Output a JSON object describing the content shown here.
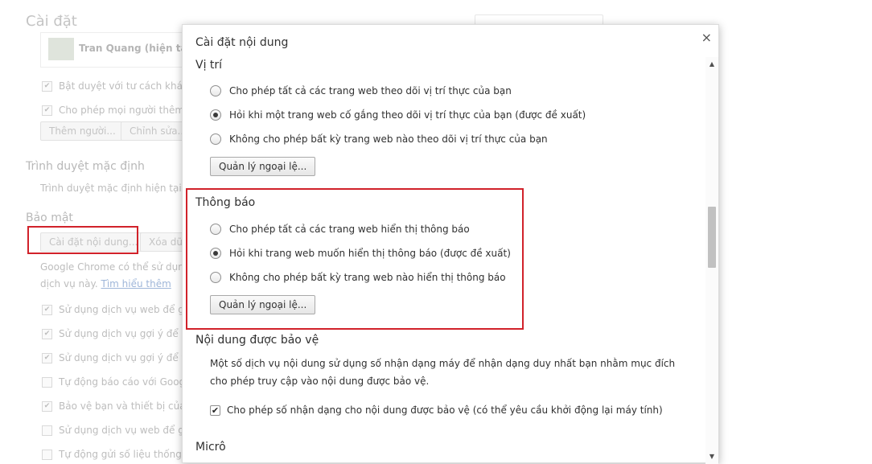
{
  "background": {
    "title": "Cài đặt",
    "profile_name": "Tran Quang (hiện tại)",
    "people_checkboxes": [
      {
        "label": "Bật duyệt với tư cách khách",
        "checked": true
      },
      {
        "label": "Cho phép mọi người thêm ng",
        "checked": true
      }
    ],
    "add_person_button": "Thêm người...",
    "edit_button": "Chỉnh sửa...",
    "default_browser_heading": "Trình duyệt mặc định",
    "default_browser_text": "Trình duyệt mặc định hiện tại là C",
    "security_heading": "Bảo mật",
    "content_settings_button": "Cài đặt nội dung...",
    "clear_data_button": "Xóa dữ",
    "info_text_line1": "Google Chrome có thể sử dụng d",
    "info_text_line2": "dịch vụ này.",
    "learn_more_link": "Tìm hiểu thêm",
    "security_checkboxes": [
      {
        "label": "Sử dụng dịch vụ web để giúp",
        "checked": true
      },
      {
        "label": "Sử dụng dịch vụ gợi ý để giú",
        "checked": true
      },
      {
        "label": "Sử dụng dịch vụ gợi ý để tải t",
        "checked": true
      },
      {
        "label": "Tự động báo cáo với Google",
        "checked": false
      },
      {
        "label": "Bảo vệ bạn và thiết bị của bạ",
        "checked": true
      },
      {
        "label": "Sử dụng dịch vụ web để giúp",
        "checked": false
      },
      {
        "label": "Tự động gửi số liệu thống kê",
        "checked": false
      }
    ]
  },
  "dialog": {
    "title": "Cài đặt nội dung",
    "close_symbol": "×",
    "location": {
      "heading": "Vị trí",
      "options": [
        {
          "label": "Cho phép tất cả các trang web theo dõi vị trí thực của bạn",
          "checked": false
        },
        {
          "label": "Hỏi khi một trang web cố gắng theo dõi vị trí thực của bạn (được đề xuất)",
          "checked": true
        },
        {
          "label": "Không cho phép bất kỳ trang web nào theo dõi vị trí thực của bạn",
          "checked": false
        }
      ],
      "exceptions_button": "Quản lý ngoại lệ..."
    },
    "notifications": {
      "heading": "Thông báo",
      "options": [
        {
          "label": "Cho phép tất cả các trang web hiển thị thông báo",
          "checked": false
        },
        {
          "label": "Hỏi khi trang web muốn hiển thị thông báo (được đề xuất)",
          "checked": true
        },
        {
          "label": "Không cho phép bất kỳ trang web nào hiển thị thông báo",
          "checked": false
        }
      ],
      "exceptions_button": "Quản lý ngoại lệ..."
    },
    "protected_content": {
      "heading": "Nội dung được bảo vệ",
      "description": "Một số dịch vụ nội dung sử dụng số nhận dạng máy để nhận dạng duy nhất bạn nhằm mục đích cho phép truy cập vào nội dung được bảo vệ.",
      "checkbox_label": "Cho phép số nhận dạng cho nội dung được bảo vệ (có thể yêu cầu khởi động lại máy tính)",
      "checkbox_checked": true
    },
    "microphone": {
      "heading": "Micrô"
    },
    "highlight_color": "#d1222a"
  }
}
